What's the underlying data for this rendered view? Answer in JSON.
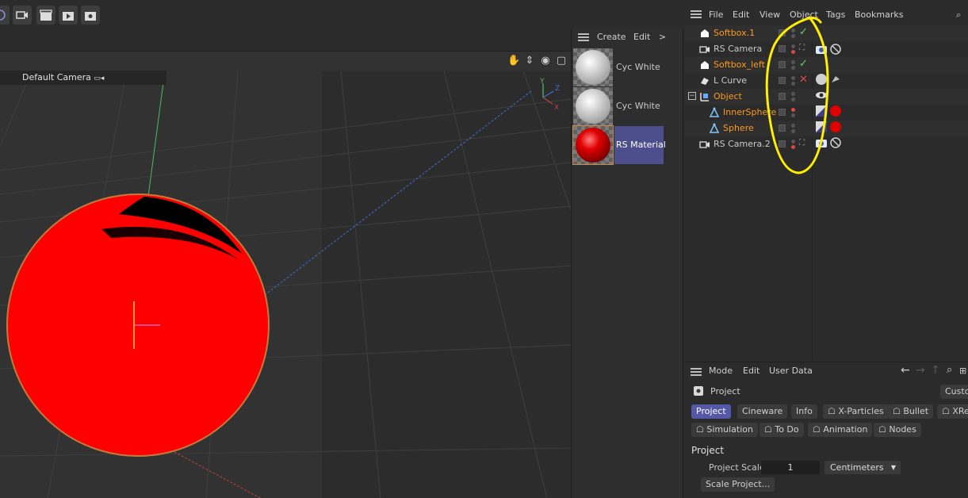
{
  "viewport": {
    "camera_label": "Default Camera",
    "axes": {
      "y": "Y",
      "z": "Z",
      "x": "X"
    }
  },
  "material_panel": {
    "menu": [
      "Create",
      "Edit",
      ">"
    ],
    "materials": [
      {
        "name": "Cyc White"
      },
      {
        "name": "Cyc White"
      },
      {
        "name": "RS Material"
      }
    ]
  },
  "object_manager": {
    "menu": [
      "File",
      "Edit",
      "View",
      "Object",
      "Tags",
      "Bookmarks"
    ],
    "objects": [
      {
        "name": "Softbox.1",
        "color": "#ff9a1a",
        "status": "check"
      },
      {
        "name": "RS Camera",
        "color": "#c8c8c8",
        "status": ""
      },
      {
        "name": "Softbox_left",
        "color": "#ff9a1a",
        "status": "check"
      },
      {
        "name": "L Curve",
        "color": "#c8c8c8",
        "status": "cross"
      },
      {
        "name": "Object",
        "color": "#ff9a1a",
        "status": ""
      },
      {
        "name": "InnerSphere",
        "color": "#ff9a1a",
        "status": ""
      },
      {
        "name": "Sphere",
        "color": "#ff9a1a",
        "status": ""
      },
      {
        "name": "RS Camera.2",
        "color": "#c8c8c8",
        "status": ""
      }
    ]
  },
  "attribute_manager": {
    "menu": [
      "Mode",
      "Edit",
      "User Data"
    ],
    "object_label": "Project",
    "custom_button": "Custo",
    "tabs_row1": [
      "Project",
      "Cineware",
      "Info",
      "X-Particles",
      "Bullet",
      "XRe"
    ],
    "tabs_row2": [
      "Simulation",
      "To Do",
      "Animation",
      "Nodes"
    ],
    "section_title": "Project",
    "project_scale_label": "Project Scale",
    "project_scale_value": "1",
    "unit_value": "Centimeters",
    "scale_button": "Scale Project..."
  },
  "colors": {
    "accent": "#5458a6",
    "object_orange": "#ff9a1a",
    "annotation_yellow": "#ffee00",
    "sphere_red": "#ff0000"
  }
}
